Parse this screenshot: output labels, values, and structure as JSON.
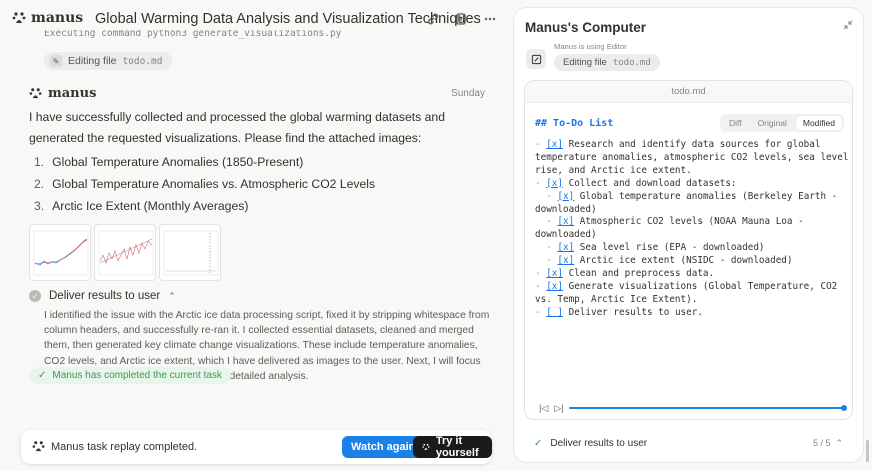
{
  "app": {
    "logo_text": "manus"
  },
  "chat": {
    "title": "Global Warming Data Analysis and Visualization Techniques",
    "partial_command": "Executing command python3 generate_visualizations.py",
    "edit_pill": "Editing file",
    "edit_file": "todo.md",
    "sender": "manus",
    "day": "Sunday",
    "message": "I have successfully collected and processed the global warming datasets and generated the requested visualizations. Please find the attached images:",
    "list": [
      {
        "num": "1.",
        "text": "Global Temperature Anomalies (1850-Present)"
      },
      {
        "num": "2.",
        "text": "Global Temperature Anomalies vs. Atmospheric CO2 Levels"
      },
      {
        "num": "3.",
        "text": "Arctic Ice Extent (Monthly Averages)"
      }
    ],
    "step_title": "Deliver results to user",
    "step_desc": "I identified the issue with the Arctic ice data processing script, fixed it by stripping whitespace from column headers, and successfully re-ran it. I collected essential datasets, cleaned and merged them, then generated key climate change visualizations. These include temperature anomalies, CO2 levels, and Arctic ice extent, which I have delivered as images to the user. Next, I will focus on finalizing data sources and preparing detailed analysis.",
    "done_badge": "Manus has completed the current task"
  },
  "replay": {
    "text": "Manus task replay completed.",
    "watch_label": "Watch again",
    "try_label": "Try it yourself"
  },
  "computer": {
    "title": "Manus's Computer",
    "using_label": "Manus is using Editor",
    "pill_action": "Editing file",
    "pill_file": "todo.md",
    "file_header": "todo.md",
    "todo_heading": "## To-Do List",
    "tabs": [
      "Diff",
      "Original",
      "Modified"
    ],
    "active_tab": "Modified",
    "lines": [
      {
        "indent": "",
        "box": "[x]",
        "text": " Research and identify data sources for global temperature anomalies, atmospheric CO2 levels, sea level rise, and Arctic ice extent."
      },
      {
        "indent": "",
        "box": "[x]",
        "text": " Collect and download datasets:"
      },
      {
        "indent": "  ",
        "box": "[x]",
        "text": " Global temperature anomalies (Berkeley Earth - downloaded)"
      },
      {
        "indent": "  ",
        "box": "[x]",
        "text": " Atmospheric CO2 levels (NOAA Mauna Loa - downloaded)"
      },
      {
        "indent": "  ",
        "box": "[x]",
        "text": " Sea level rise (EPA - downloaded)"
      },
      {
        "indent": "  ",
        "box": "[x]",
        "text": " Arctic ice extent (NSIDC - downloaded)"
      },
      {
        "indent": "",
        "box": "[x]",
        "text": " Clean and preprocess data."
      },
      {
        "indent": "",
        "box": "[x]",
        "text": " Generate visualizations (Global Temperature, CO2 vs. Temp, Arctic Ice Extent)."
      },
      {
        "indent": "",
        "box": "[ ]",
        "text": " Deliver results to user."
      }
    ],
    "progress": 1.0,
    "footer_step": "Deliver results to user",
    "footer_count": "5 / 5"
  },
  "colors": {
    "accent": "#1a81e8",
    "success": "#3a9a52",
    "dash": "#e6863c"
  }
}
